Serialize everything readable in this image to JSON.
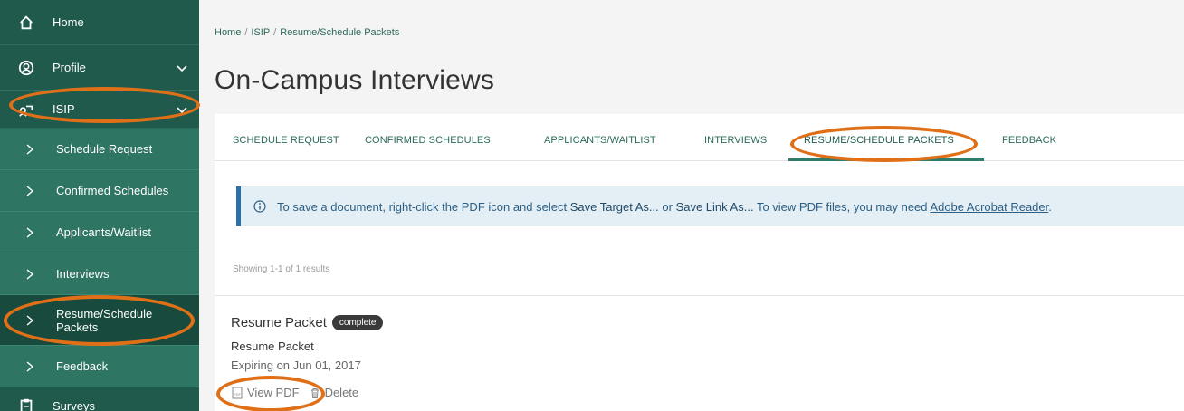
{
  "sidebar": {
    "items": [
      {
        "label": "Home",
        "icon": "home-icon"
      },
      {
        "label": "Profile",
        "icon": "profile-icon"
      },
      {
        "label": "ISIP",
        "icon": "isip-icon"
      }
    ],
    "sub_items": [
      {
        "label": "Schedule Request"
      },
      {
        "label": "Confirmed Schedules"
      },
      {
        "label": "Applicants/Waitlist"
      },
      {
        "label": "Interviews"
      },
      {
        "label": "Resume/Schedule Packets"
      },
      {
        "label": "Feedback"
      }
    ],
    "surveys": {
      "label": "Surveys",
      "icon": "clipboard-icon"
    }
  },
  "breadcrumb": {
    "home": "Home",
    "isip": "ISIP",
    "current": "Resume/Schedule Packets",
    "separator": "/"
  },
  "page_title": "On-Campus Interviews",
  "tabs": [
    {
      "label": "SCHEDULE REQUEST"
    },
    {
      "label": "CONFIRMED SCHEDULES"
    },
    {
      "label": "APPLICANTS/WAITLIST"
    },
    {
      "label": "INTERVIEWS"
    },
    {
      "label": "RESUME/SCHEDULE PACKETS",
      "active": true
    },
    {
      "label": "FEEDBACK"
    }
  ],
  "info": {
    "text1": "To save a document, right-click the PDF icon and select ",
    "save_target": "Save Target As...",
    "text2": " or ",
    "save_link": "Save Link As...",
    "text3": " To view PDF files, you may need ",
    "reader_link": "Adobe Acrobat Reader",
    "text4": "."
  },
  "results": "Showing 1-1 of 1 results",
  "packet": {
    "title": "Resume Packet",
    "badge": "complete",
    "subtitle": "Resume Packet",
    "expiry": "Expiring on Jun 01, 2017",
    "view_pdf": "View PDF",
    "delete": "Delete"
  },
  "colors": {
    "sidebar": "#1f5a4c",
    "submenu": "#2e7563",
    "accent": "#2e7d6a",
    "highlight": "#e07018",
    "info_bar": "#2d6fa8"
  }
}
